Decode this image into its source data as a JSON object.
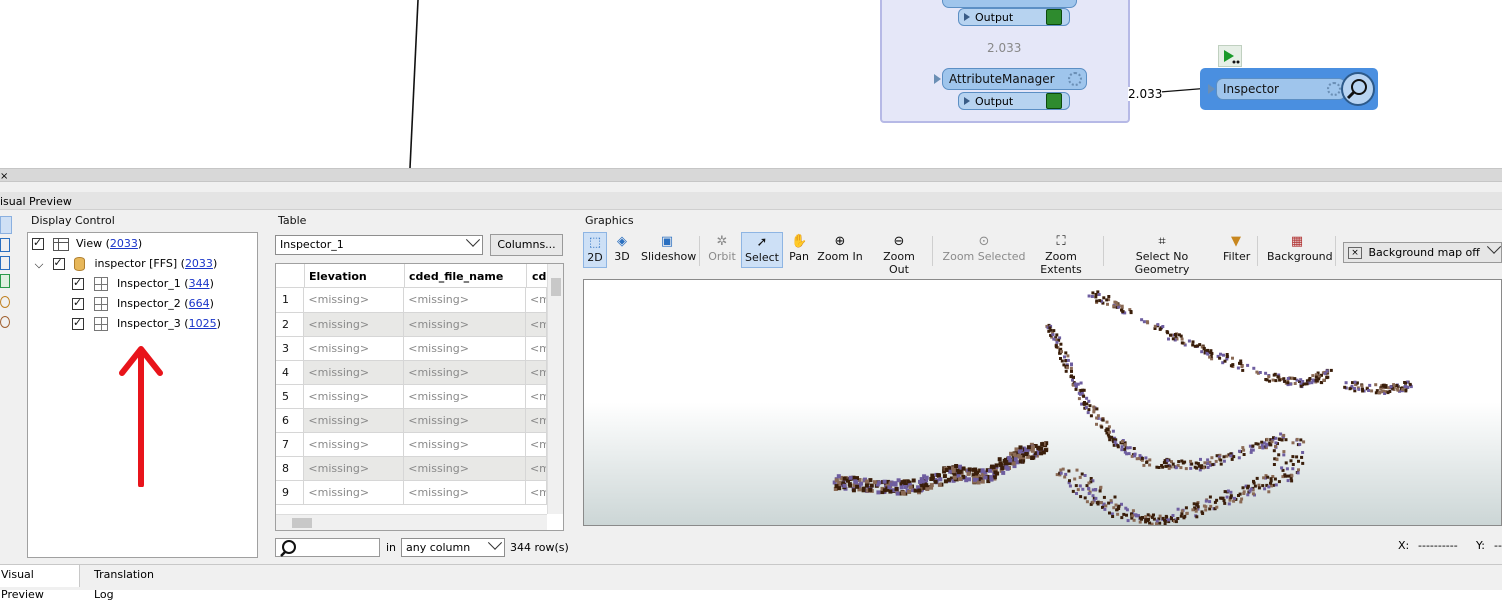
{
  "workspace": {
    "bookmark_value": "2.033",
    "transformers": [
      {
        "name": "AttributeManager",
        "output": "Output"
      }
    ],
    "top_output_label": "Output",
    "link_count": "2.033",
    "inspector_label": "Inspector"
  },
  "panel": {
    "title": "isual Preview",
    "display_control": {
      "label": "Display Control",
      "view_label": "View (",
      "view_count": "2033",
      "dataset_label": "inspector [FFS] (",
      "dataset_count": "2033",
      "close_paren": ")",
      "layers": [
        {
          "name": "Inspector_1 (",
          "count": "344"
        },
        {
          "name": "Inspector_2 (",
          "count": "664"
        },
        {
          "name": "Inspector_3 (",
          "count": "1025"
        }
      ]
    },
    "table": {
      "label": "Table",
      "selected": "Inspector_1",
      "columns_button": "Columns...",
      "headers": [
        "Elevation",
        "cded_file_name",
        "cd"
      ],
      "rows": [
        {
          "n": "1",
          "c1": "<missing>",
          "c2": "<missing>",
          "c3": "<m"
        },
        {
          "n": "2",
          "c1": "<missing>",
          "c2": "<missing>",
          "c3": "<m"
        },
        {
          "n": "3",
          "c1": "<missing>",
          "c2": "<missing>",
          "c3": "<m"
        },
        {
          "n": "4",
          "c1": "<missing>",
          "c2": "<missing>",
          "c3": "<m"
        },
        {
          "n": "5",
          "c1": "<missing>",
          "c2": "<missing>",
          "c3": "<m"
        },
        {
          "n": "6",
          "c1": "<missing>",
          "c2": "<missing>",
          "c3": "<m"
        },
        {
          "n": "7",
          "c1": "<missing>",
          "c2": "<missing>",
          "c3": "<m"
        },
        {
          "n": "8",
          "c1": "<missing>",
          "c2": "<missing>",
          "c3": "<m"
        },
        {
          "n": "9",
          "c1": "<missing>",
          "c2": "<missing>",
          "c3": "<m"
        }
      ],
      "search_in": "in",
      "search_scope": "any column",
      "row_count": "344 row(s)"
    },
    "graphics": {
      "label": "Graphics",
      "tools": [
        "2D",
        "3D",
        "Slideshow",
        "Orbit",
        "Select",
        "Pan",
        "Zoom In",
        "Zoom Out",
        "Zoom Selected",
        "Zoom Extents",
        "Select No Geometry",
        "Filter",
        "Background"
      ],
      "background_map": "Background map off",
      "x_label": "X:",
      "x_value": "----------",
      "y_label": "Y:",
      "y_value": "--"
    },
    "tabs": [
      "Visual Preview",
      "Translation Log"
    ]
  },
  "colors": {
    "accent": "#9fc5ec",
    "arrow": "#e8141b",
    "bookmark": "#e5e7f8",
    "point_dark": "#3a1e0a",
    "point_purple": "#6e5ea0",
    "point_brown": "#8a6a55"
  }
}
